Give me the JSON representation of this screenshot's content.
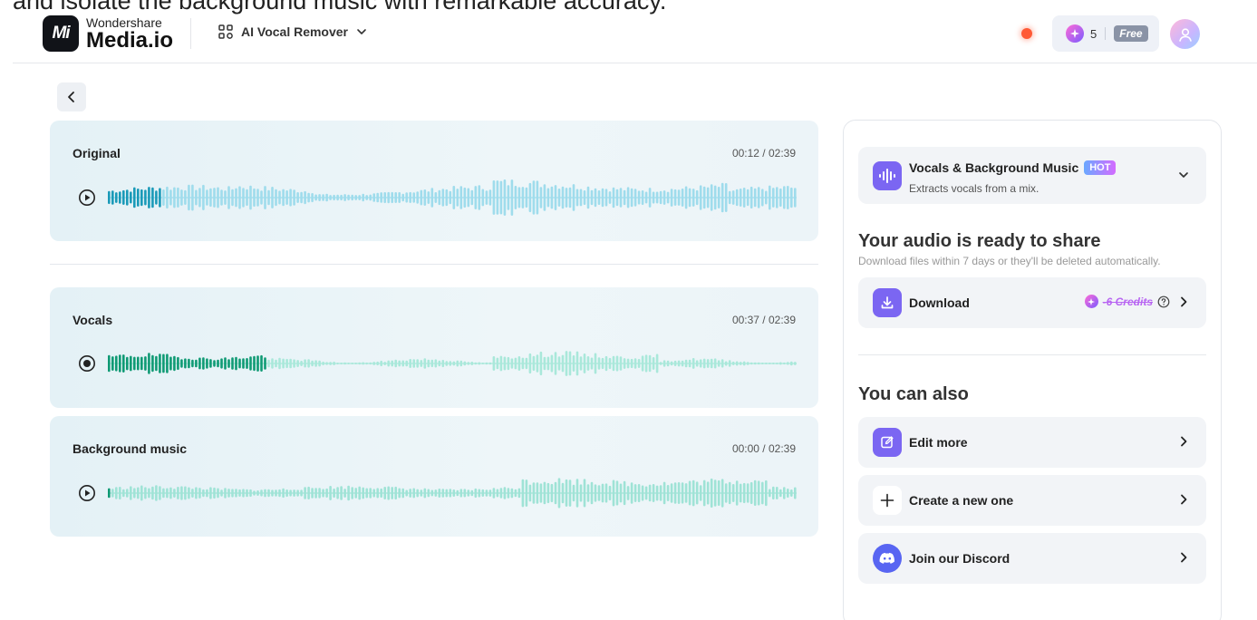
{
  "caption": "and isolate the background music with remarkable accuracy.",
  "header": {
    "brand_small": "Wondershare",
    "brand_big": "Media.io",
    "logo_mark": "Mi",
    "tool_name": "AI Vocal Remover",
    "credits_count": "5",
    "plan_badge": "Free"
  },
  "tracks": [
    {
      "title": "Original",
      "time": "00:12 / 02:39",
      "play_icon": "play-circle-icon",
      "progress": 0.075,
      "colors": {
        "played": "#1a9ab8",
        "rest": "#9fdcec"
      }
    },
    {
      "title": "Vocals",
      "time": "00:37 / 02:39",
      "play_icon": "record-circle-icon",
      "progress": 0.23,
      "colors": {
        "played": "#0f9a74",
        "rest": "#a9e8da"
      }
    },
    {
      "title": "Background music",
      "time": "00:00 / 02:39",
      "play_icon": "play-circle-icon",
      "progress": 0,
      "colors": {
        "played": "#0f9a74",
        "rest": "#9fe3d6"
      }
    }
  ],
  "panel": {
    "mode": {
      "title": "Vocals & Background Music",
      "badge": "HOT",
      "subtitle": "Extracts vocals from a mix."
    },
    "ready_title": "Your audio is ready to share",
    "ready_subtitle": "Download files within 7 days or they'll be deleted automatically.",
    "download_label": "Download",
    "download_credits": "-6 Credits",
    "also_title": "You can also",
    "actions": [
      {
        "label": "Edit more",
        "icon": "edit-icon"
      },
      {
        "label": "Create a new one",
        "icon": "plus-icon"
      },
      {
        "label": "Join our Discord",
        "icon": "discord-icon"
      }
    ]
  },
  "colors": {
    "accent": "#7b66f2",
    "discord": "#5865f2",
    "credit_pink": "#b865f2"
  }
}
